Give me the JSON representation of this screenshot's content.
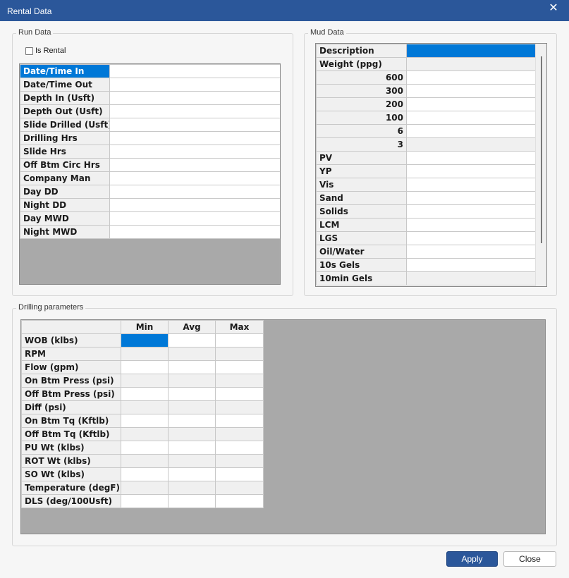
{
  "window": {
    "title": "Rental Data",
    "close_glyph": "✕"
  },
  "run_data": {
    "legend": "Run Data",
    "is_rental_label": "Is Rental",
    "rows": [
      "Date/Time In",
      "Date/Time Out",
      "Depth In (Usft)",
      "Depth Out (Usft)",
      "Slide Drilled (Usft)",
      "Drilling Hrs",
      "Slide Hrs",
      "Off Btm Circ Hrs",
      "Company Man",
      "Day DD",
      "Night DD",
      "Day MWD",
      "Night MWD"
    ]
  },
  "mud_data": {
    "legend": "Mud Data",
    "rows": [
      {
        "label": "Description",
        "align": "left"
      },
      {
        "label": "Weight (ppg)",
        "align": "left"
      },
      {
        "label": "600",
        "align": "right"
      },
      {
        "label": "300",
        "align": "right"
      },
      {
        "label": "200",
        "align": "right"
      },
      {
        "label": "100",
        "align": "right"
      },
      {
        "label": "6",
        "align": "right"
      },
      {
        "label": "3",
        "align": "right"
      },
      {
        "label": "PV",
        "align": "left"
      },
      {
        "label": "YP",
        "align": "left"
      },
      {
        "label": "Vis",
        "align": "left"
      },
      {
        "label": "Sand",
        "align": "left"
      },
      {
        "label": "Solids",
        "align": "left"
      },
      {
        "label": "LCM",
        "align": "left"
      },
      {
        "label": "LGS",
        "align": "left"
      },
      {
        "label": "Oil/Water",
        "align": "left"
      },
      {
        "label": "10s Gels",
        "align": "left"
      },
      {
        "label": "10min Gels",
        "align": "left"
      }
    ]
  },
  "drilling": {
    "legend": "Drilling parameters",
    "columns": [
      "Min",
      "Avg",
      "Max"
    ],
    "rows": [
      "WOB (klbs)",
      "RPM",
      "Flow (gpm)",
      "On Btm Press (psi)",
      "Off Btm Press (psi)",
      "Diff (psi)",
      "On Btm Tq (Kftlb)",
      "Off Btm Tq (Kftlb)",
      "PU Wt (klbs)",
      "ROT Wt (klbs)",
      "SO Wt (klbs)",
      "Temperature (degF)",
      "DLS (deg/100Usft)"
    ]
  },
  "buttons": {
    "apply": "Apply",
    "close": "Close"
  },
  "colors": {
    "titlebar": "#2b579a",
    "selection": "#0078d7",
    "grid_empty": "#a9a9a9"
  }
}
